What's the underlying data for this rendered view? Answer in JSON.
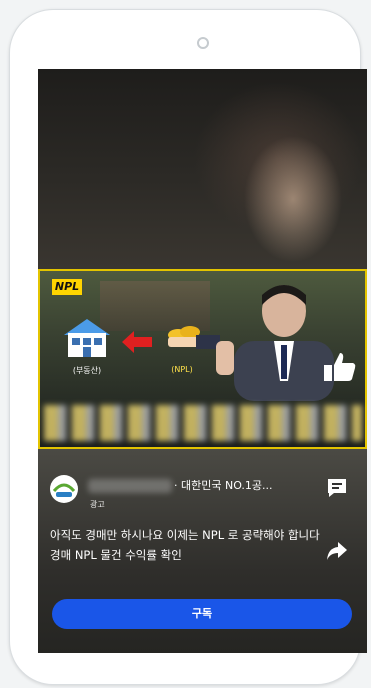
{
  "ad": {
    "badge": "NPL",
    "house_label": "(부동산)",
    "npl_label": "(NPL)"
  },
  "channel": {
    "name": "· 대한민국 NO.1공...",
    "sub_label": "광고"
  },
  "description": "아직도 경매만 하시나요 이제는 NPL 로 공략해야 합니다 경매 NPL 물건 수익률 확인",
  "actions": {
    "subscribe_label": "구독"
  },
  "colors": {
    "badge_yellow": "#ffd400",
    "frame_border": "#e3c400",
    "subscribe_blue": "#1a56e8",
    "arrow_red": "#e02020"
  },
  "icons": [
    "camera-icon",
    "house-icon",
    "arrow-left-icon",
    "coins-icon",
    "thumbs-up-icon",
    "comment-icon",
    "share-icon"
  ]
}
